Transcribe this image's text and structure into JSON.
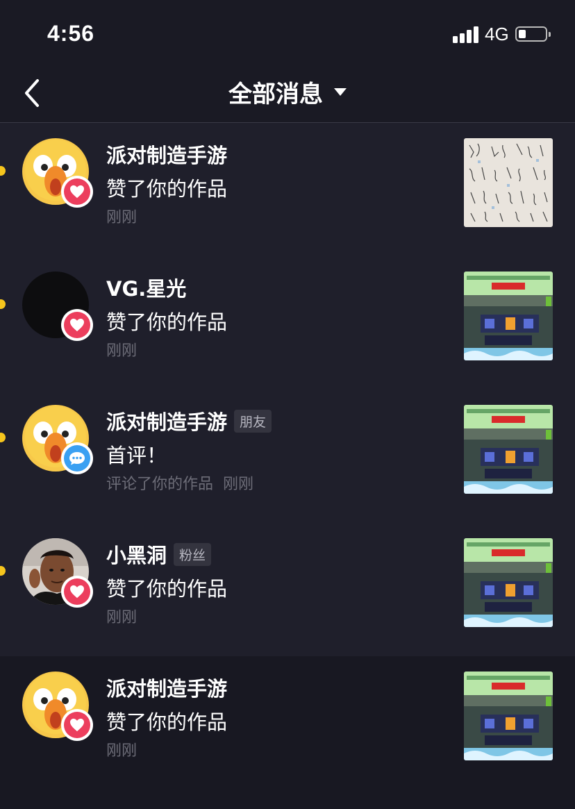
{
  "status": {
    "time": "4:56",
    "network": "4G"
  },
  "nav": {
    "title": "全部消息"
  },
  "items": [
    {
      "name": "派对制造手游",
      "tag": "",
      "action": "赞了你的作品",
      "meta1": "刚刚",
      "meta2": "",
      "badge": "like-icon",
      "avatar": "duck-avatar",
      "thumb": "sketch-grid-thumbnail"
    },
    {
      "name": "VG.星光",
      "tag": "",
      "action": "赞了你的作品",
      "meta1": "刚刚",
      "meta2": "",
      "badge": "like-icon",
      "avatar": "dark-avatar",
      "thumb": "game-screenshot-thumbnail"
    },
    {
      "name": "派对制造手游",
      "tag": "朋友",
      "action": "首评！",
      "meta1": "评论了你的作品",
      "meta2": "刚刚",
      "badge": "comment-icon",
      "avatar": "duck-avatar",
      "thumb": "game-screenshot-thumbnail"
    },
    {
      "name": "小黑洞",
      "tag": "粉丝",
      "action": "赞了你的作品",
      "meta1": "刚刚",
      "meta2": "",
      "badge": "like-icon",
      "avatar": "person-avatar",
      "thumb": "game-screenshot-thumbnail"
    },
    {
      "name": "派对制造手游",
      "tag": "",
      "action": "赞了你的作品",
      "meta1": "刚刚",
      "meta2": "",
      "badge": "like-icon",
      "avatar": "duck-avatar",
      "thumb": "game-screenshot-thumbnail"
    }
  ],
  "colors": {
    "background": "#1f1f2b",
    "like": "#ec3e5d",
    "comment": "#3aa0f2",
    "unread": "#f6c51d"
  }
}
